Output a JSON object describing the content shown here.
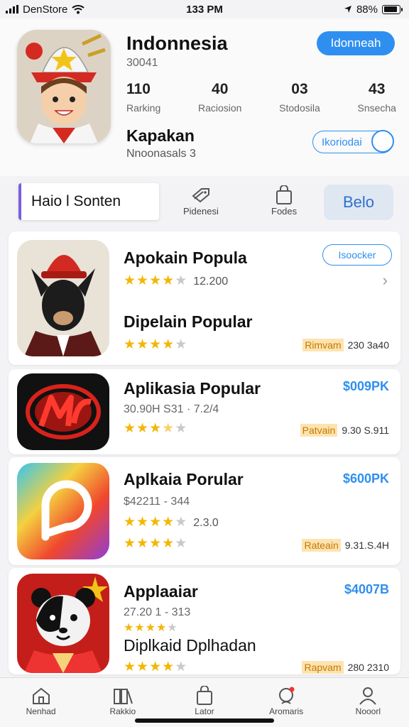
{
  "status": {
    "carrier": "DenStore",
    "time": "133 PM",
    "battery": "88%",
    "battery_level": 0.88
  },
  "header": {
    "title": "Indonnesia",
    "subtitle": "30041",
    "primary_button": "Idonneah",
    "stats": [
      {
        "value": "110",
        "label": "Rarking"
      },
      {
        "value": "40",
        "label": "Raciosion"
      },
      {
        "value": "03",
        "label": "Stodosila"
      },
      {
        "value": "43",
        "label": "Snsecha"
      }
    ],
    "title2": "Kapakan",
    "subtitle2": "Nnoonasals 3",
    "secondary_button": "Ikoriodai"
  },
  "tabs": {
    "active_label": "Haio l Sonten",
    "items": [
      {
        "label": "Pidenesi",
        "icon": "tag-icon"
      },
      {
        "label": "Fodes",
        "icon": "bag-icon"
      }
    ],
    "button_label": "Belo"
  },
  "apps": [
    {
      "name": "Apokain Popula",
      "stars": 4,
      "count": "12.200",
      "name2": "Dipelain Popular",
      "stars2": 4,
      "action": "Isoocker",
      "tag": "Rimvam",
      "tag_rest": "230 3a40",
      "icon": "red-hat-character-icon"
    },
    {
      "name": "Aplikasia Popular",
      "meta": "30.90H S31 · 7.2/4",
      "stars": 3.5,
      "price": "$009PK",
      "tag": "Patvain",
      "tag_rest": "9.30 S.911",
      "icon": "red-m-logo-icon"
    },
    {
      "name": "Aplkaia Porular",
      "meta": "$42211 - 344",
      "stars": 4,
      "count": "2.3.0",
      "stars2": 4,
      "price": "$600PK",
      "tag": "Rateain",
      "tag_rest": "9.31.S.4H",
      "icon": "gradient-p-logo-icon"
    },
    {
      "name": "Applaaiar",
      "meta": "27.20 1 - 313",
      "stars": 4,
      "name2": "Diplkaid Dplhadan",
      "stars2": 4,
      "price": "$4007B",
      "tag": "Rapvam",
      "tag_rest": "280 2310",
      "icon": "panda-character-icon"
    }
  ],
  "bottom_nav": [
    {
      "label": "Nenhad",
      "icon": "home-icon"
    },
    {
      "label": "Rakkio",
      "icon": "books-icon"
    },
    {
      "label": "Lator",
      "icon": "bag-icon"
    },
    {
      "label": "Aromaris",
      "icon": "notifications-icon"
    },
    {
      "label": "Nooorl",
      "icon": "profile-icon"
    }
  ],
  "colors": {
    "accent": "#2f8ff0",
    "star": "#f2b705",
    "tab_accent": "#7a5ee0"
  }
}
